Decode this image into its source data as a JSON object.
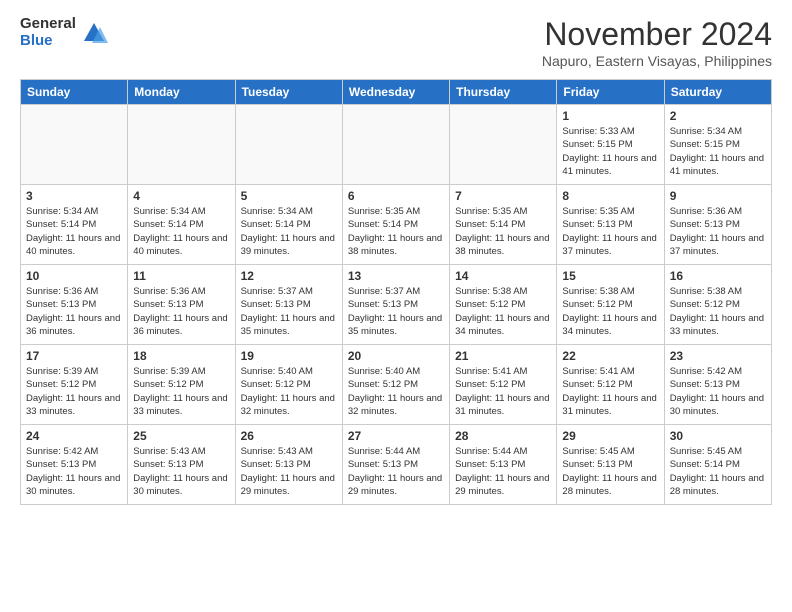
{
  "logo": {
    "general": "General",
    "blue": "Blue"
  },
  "header": {
    "month": "November 2024",
    "location": "Napuro, Eastern Visayas, Philippines"
  },
  "weekdays": [
    "Sunday",
    "Monday",
    "Tuesday",
    "Wednesday",
    "Thursday",
    "Friday",
    "Saturday"
  ],
  "weeks": [
    [
      {
        "day": "",
        "info": ""
      },
      {
        "day": "",
        "info": ""
      },
      {
        "day": "",
        "info": ""
      },
      {
        "day": "",
        "info": ""
      },
      {
        "day": "",
        "info": ""
      },
      {
        "day": "1",
        "info": "Sunrise: 5:33 AM\nSunset: 5:15 PM\nDaylight: 11 hours and 41 minutes."
      },
      {
        "day": "2",
        "info": "Sunrise: 5:34 AM\nSunset: 5:15 PM\nDaylight: 11 hours and 41 minutes."
      }
    ],
    [
      {
        "day": "3",
        "info": "Sunrise: 5:34 AM\nSunset: 5:14 PM\nDaylight: 11 hours and 40 minutes."
      },
      {
        "day": "4",
        "info": "Sunrise: 5:34 AM\nSunset: 5:14 PM\nDaylight: 11 hours and 40 minutes."
      },
      {
        "day": "5",
        "info": "Sunrise: 5:34 AM\nSunset: 5:14 PM\nDaylight: 11 hours and 39 minutes."
      },
      {
        "day": "6",
        "info": "Sunrise: 5:35 AM\nSunset: 5:14 PM\nDaylight: 11 hours and 38 minutes."
      },
      {
        "day": "7",
        "info": "Sunrise: 5:35 AM\nSunset: 5:14 PM\nDaylight: 11 hours and 38 minutes."
      },
      {
        "day": "8",
        "info": "Sunrise: 5:35 AM\nSunset: 5:13 PM\nDaylight: 11 hours and 37 minutes."
      },
      {
        "day": "9",
        "info": "Sunrise: 5:36 AM\nSunset: 5:13 PM\nDaylight: 11 hours and 37 minutes."
      }
    ],
    [
      {
        "day": "10",
        "info": "Sunrise: 5:36 AM\nSunset: 5:13 PM\nDaylight: 11 hours and 36 minutes."
      },
      {
        "day": "11",
        "info": "Sunrise: 5:36 AM\nSunset: 5:13 PM\nDaylight: 11 hours and 36 minutes."
      },
      {
        "day": "12",
        "info": "Sunrise: 5:37 AM\nSunset: 5:13 PM\nDaylight: 11 hours and 35 minutes."
      },
      {
        "day": "13",
        "info": "Sunrise: 5:37 AM\nSunset: 5:13 PM\nDaylight: 11 hours and 35 minutes."
      },
      {
        "day": "14",
        "info": "Sunrise: 5:38 AM\nSunset: 5:12 PM\nDaylight: 11 hours and 34 minutes."
      },
      {
        "day": "15",
        "info": "Sunrise: 5:38 AM\nSunset: 5:12 PM\nDaylight: 11 hours and 34 minutes."
      },
      {
        "day": "16",
        "info": "Sunrise: 5:38 AM\nSunset: 5:12 PM\nDaylight: 11 hours and 33 minutes."
      }
    ],
    [
      {
        "day": "17",
        "info": "Sunrise: 5:39 AM\nSunset: 5:12 PM\nDaylight: 11 hours and 33 minutes."
      },
      {
        "day": "18",
        "info": "Sunrise: 5:39 AM\nSunset: 5:12 PM\nDaylight: 11 hours and 33 minutes."
      },
      {
        "day": "19",
        "info": "Sunrise: 5:40 AM\nSunset: 5:12 PM\nDaylight: 11 hours and 32 minutes."
      },
      {
        "day": "20",
        "info": "Sunrise: 5:40 AM\nSunset: 5:12 PM\nDaylight: 11 hours and 32 minutes."
      },
      {
        "day": "21",
        "info": "Sunrise: 5:41 AM\nSunset: 5:12 PM\nDaylight: 11 hours and 31 minutes."
      },
      {
        "day": "22",
        "info": "Sunrise: 5:41 AM\nSunset: 5:12 PM\nDaylight: 11 hours and 31 minutes."
      },
      {
        "day": "23",
        "info": "Sunrise: 5:42 AM\nSunset: 5:13 PM\nDaylight: 11 hours and 30 minutes."
      }
    ],
    [
      {
        "day": "24",
        "info": "Sunrise: 5:42 AM\nSunset: 5:13 PM\nDaylight: 11 hours and 30 minutes."
      },
      {
        "day": "25",
        "info": "Sunrise: 5:43 AM\nSunset: 5:13 PM\nDaylight: 11 hours and 30 minutes."
      },
      {
        "day": "26",
        "info": "Sunrise: 5:43 AM\nSunset: 5:13 PM\nDaylight: 11 hours and 29 minutes."
      },
      {
        "day": "27",
        "info": "Sunrise: 5:44 AM\nSunset: 5:13 PM\nDaylight: 11 hours and 29 minutes."
      },
      {
        "day": "28",
        "info": "Sunrise: 5:44 AM\nSunset: 5:13 PM\nDaylight: 11 hours and 29 minutes."
      },
      {
        "day": "29",
        "info": "Sunrise: 5:45 AM\nSunset: 5:13 PM\nDaylight: 11 hours and 28 minutes."
      },
      {
        "day": "30",
        "info": "Sunrise: 5:45 AM\nSunset: 5:14 PM\nDaylight: 11 hours and 28 minutes."
      }
    ]
  ]
}
